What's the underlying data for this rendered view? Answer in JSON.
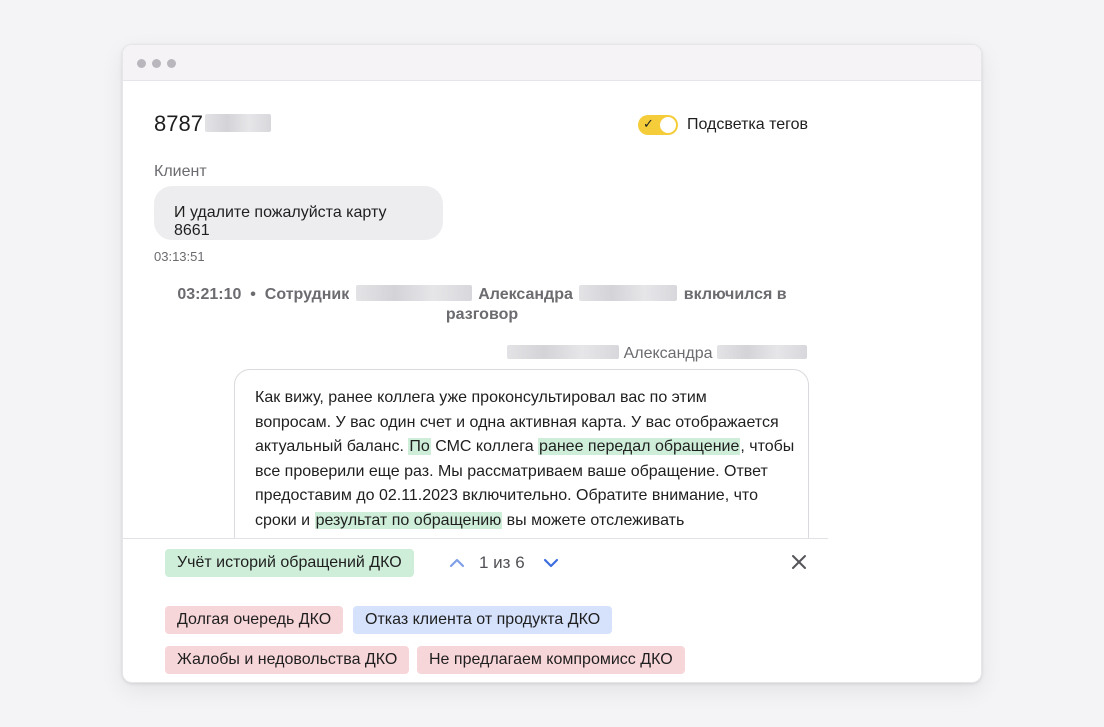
{
  "conversation": {
    "id": "8787"
  },
  "toggle": {
    "label": "Подсветка тегов",
    "checked": true,
    "color": "#f5cd3b"
  },
  "client_message": {
    "role": "Клиент",
    "text": "И удалите пожалуйста карту 8661",
    "time": "03:13:51"
  },
  "system_event": {
    "time": "03:21:10",
    "separator": "•",
    "prefix": "Сотрудник",
    "name": "Александра",
    "suffix": "включился в разговор"
  },
  "employee_message": {
    "author": "Александра",
    "lines": {
      "l1": "Как вижу, ранее коллега уже проконсультировал вас по этим",
      "l2": "вопросам. У вас один счет и одна активная карта. У вас отображается",
      "l3_a": "актуальный баланс. ",
      "l3_hl1": "По",
      "l3_b": " СМС коллега ",
      "l3_hl2": "ранее передал обращение",
      "l3_c": ", чтобы",
      "l4": "все проверили еще раз. Мы рассматриваем ваше обращение. Ответ",
      "l5": "предоставим до 02.11.2023 включительно. Обратите внимание, что",
      "l6_a": "сроки и ",
      "l6_hl": "результат по обращению",
      "l6_b": " вы можете отслеживать"
    },
    "highlight_color": "#cfeed9"
  },
  "tag_nav": {
    "active_tag": "Учёт историй обращений ДКО",
    "counter": "1 из 6"
  },
  "tags": [
    {
      "label": "Долгая очередь ДКО",
      "color": "#f7d6da"
    },
    {
      "label": "Отказ клиента от продукта ДКО",
      "color": "#d6e2fb"
    },
    {
      "label": "Жалобы и недовольства ДКО",
      "color": "#f7d6da"
    },
    {
      "label": "Не предлагаем компромисс ДКО",
      "color": "#f7d6da"
    }
  ]
}
